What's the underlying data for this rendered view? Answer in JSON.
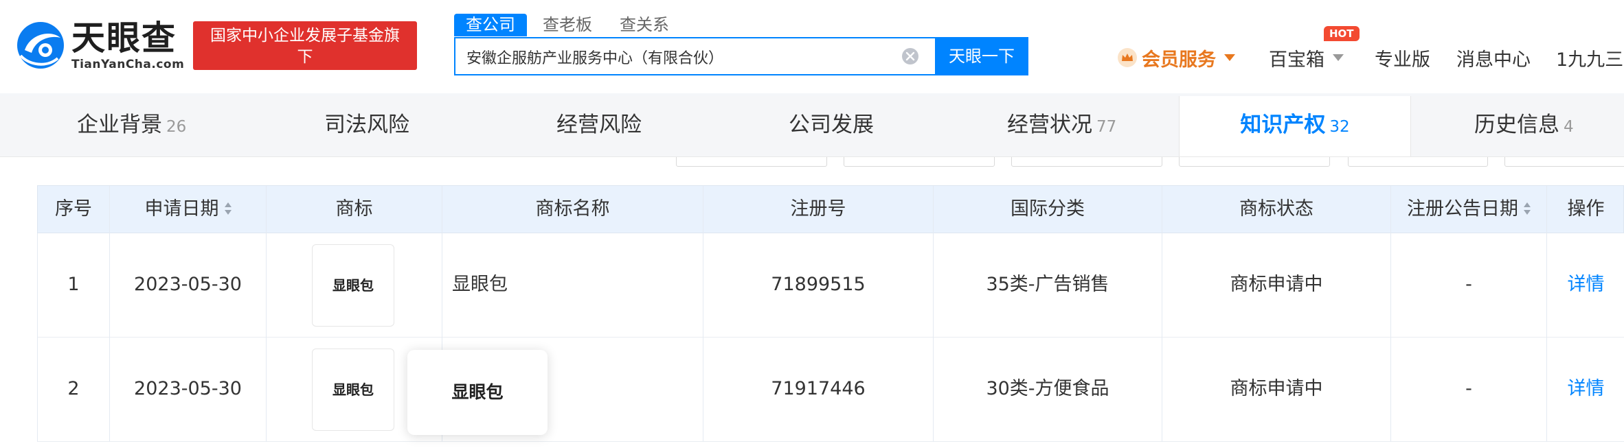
{
  "header": {
    "logo": {
      "cn": "天眼查",
      "en": "TianYanCha.com"
    },
    "promo": "国家中小企业发展子基金旗下",
    "search_tabs": [
      "查公司",
      "查老板",
      "查关系"
    ],
    "search": {
      "value": "安徽企服舫产业服务中心（有限合伙）",
      "button": "天眼一下"
    },
    "nav": {
      "vip": "会员服务",
      "baobox": "百宝箱",
      "hot": "HOT",
      "pro": "专业版",
      "messages": "消息中心",
      "user": "1九九三"
    }
  },
  "tabs": [
    {
      "label": "企业背景",
      "count": "26"
    },
    {
      "label": "司法风险",
      "count": ""
    },
    {
      "label": "经营风险",
      "count": ""
    },
    {
      "label": "公司发展",
      "count": ""
    },
    {
      "label": "经营状况",
      "count": "77"
    },
    {
      "label": "知识产权",
      "count": "32"
    },
    {
      "label": "历史信息",
      "count": "4"
    }
  ],
  "table": {
    "headers": [
      "序号",
      "申请日期",
      "商标",
      "商标名称",
      "注册号",
      "国际分类",
      "商标状态",
      "注册公告日期",
      "操作"
    ],
    "rows": [
      {
        "index": "1",
        "date": "2023-05-30",
        "logo_text": "显眼包",
        "name": "显眼包",
        "reg_no": "71899515",
        "class": "35类-广告销售",
        "status": "商标申请中",
        "notice_date": "-",
        "action": "详情"
      },
      {
        "index": "2",
        "date": "2023-05-30",
        "logo_text": "显眼包",
        "name": "",
        "reg_no": "71917446",
        "class": "30类-方便食品",
        "status": "商标申请中",
        "notice_date": "-",
        "action": "详情"
      }
    ]
  },
  "popover": {
    "text": "显眼包"
  },
  "colors": {
    "brand": "#0084ff",
    "promo": "#e0312d",
    "vip": "#e8781f",
    "hot": "#f34a31"
  }
}
